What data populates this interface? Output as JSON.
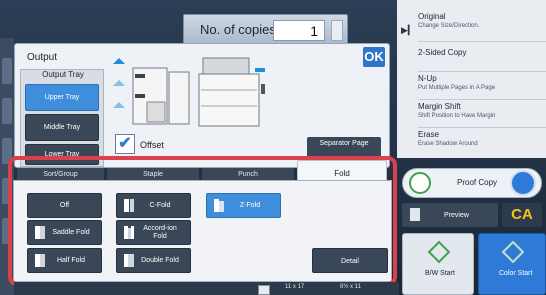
{
  "copies": {
    "label": "No. of copies",
    "value": "1"
  },
  "output": {
    "title": "Output",
    "ok_label": "OK",
    "tray_group_title": "Output Tray",
    "trays": [
      "Upper Tray",
      "Middle Tray",
      "Lower Tray"
    ],
    "offset_label": "Offset",
    "separator_label": "Separator Page"
  },
  "tabs": [
    "Sort/Group",
    "Staple",
    "Punch",
    "Fold"
  ],
  "fold": {
    "options": [
      {
        "label": "Off",
        "active": false
      },
      {
        "label": "C-Fold",
        "active": false
      },
      {
        "label": "Z-Fold",
        "active": true
      },
      {
        "label": "Saddle Fold",
        "active": false
      },
      {
        "label": "Accord-ion Fold",
        "active": false
      },
      {
        "label": "Half Fold",
        "active": false
      },
      {
        "label": "Double Fold",
        "active": false
      }
    ],
    "detail_label": "Detail"
  },
  "bottom": {
    "paper_size_1": "11 x 17",
    "paper_size_2": "8½ x 11"
  },
  "right_panel": {
    "items": [
      {
        "title": "Original",
        "sub": "Change Size/Direction."
      },
      {
        "title": "2-Sided Copy",
        "sub": ""
      },
      {
        "title": "N-Up",
        "sub": "Put Multiple Pages in A Page"
      },
      {
        "title": "Margin Shift",
        "sub": "Shift Position to Have Margin"
      },
      {
        "title": "Erase",
        "sub": "Erase Shadow Around"
      }
    ],
    "proof_copy_label": "Proof Copy",
    "preview_label": "Preview",
    "ca_label": "CA",
    "bw_start_label": "B/W Start",
    "color_start_label": "Color Start"
  },
  "colors": {
    "accent": "#3f8edc",
    "highlight": "#d9424a",
    "ca": "#f3c31b",
    "start_green": "#3fa34d"
  }
}
